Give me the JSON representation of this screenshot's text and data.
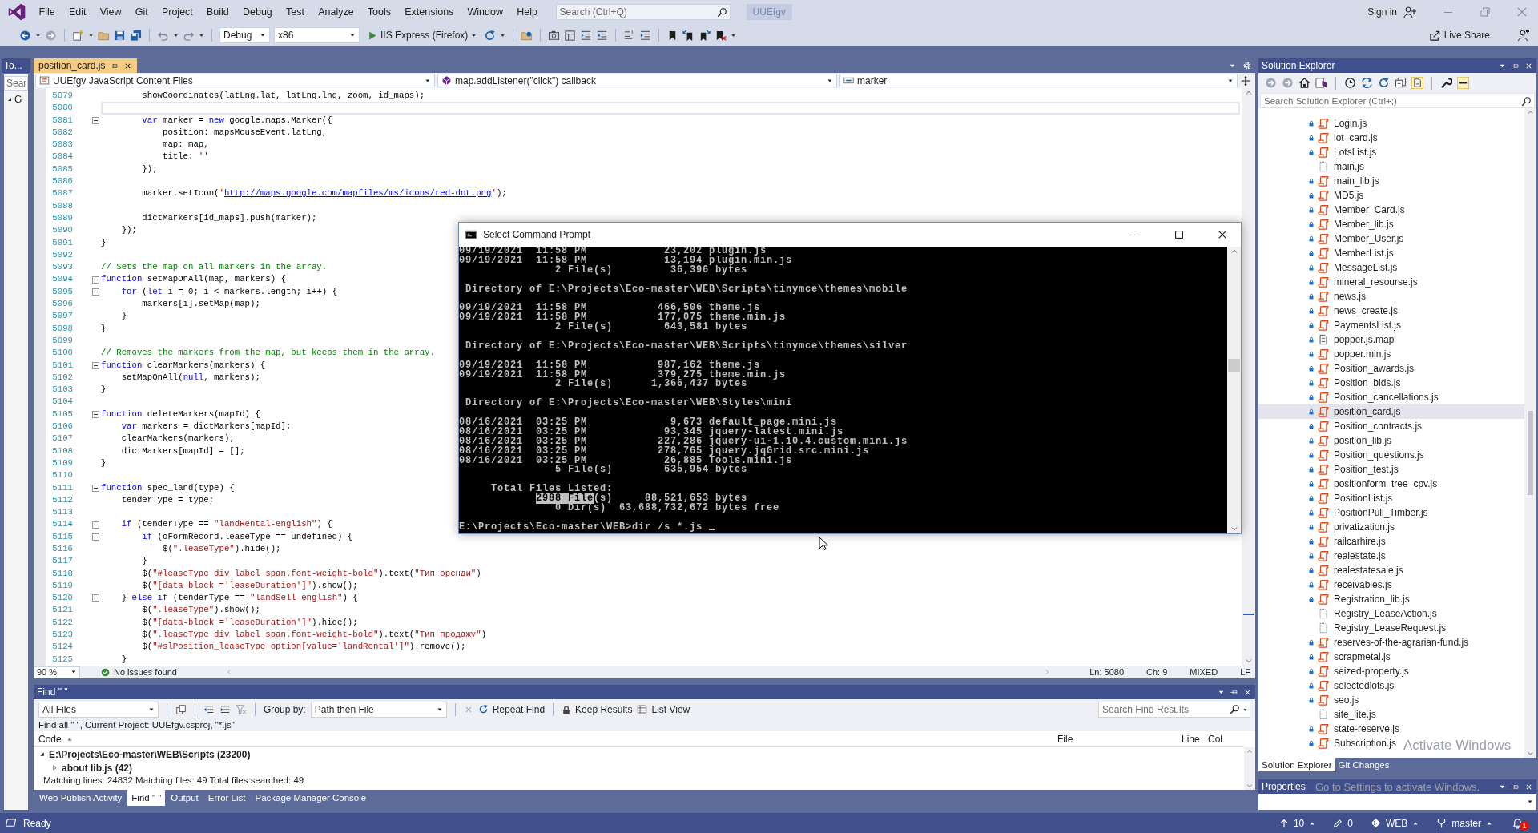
{
  "menu_bar": {
    "items": [
      "File",
      "Edit",
      "View",
      "Git",
      "Project",
      "Build",
      "Debug",
      "Test",
      "Analyze",
      "Tools",
      "Extensions",
      "Window",
      "Help"
    ],
    "search": {
      "placeholder": "Search (Ctrl+Q)"
    },
    "solution_badge": "UUEfgv",
    "sign_in": "Sign in"
  },
  "toolbar": {
    "configuration": "Debug",
    "platform": "x86",
    "run_target": "IIS Express (Firefox)",
    "live_share": "Live Share"
  },
  "left_panel": {
    "tab": "To...",
    "search": {
      "placeholder": "Sear"
    },
    "tree_item": "G"
  },
  "document_tabs": [
    {
      "label": "position_card.js",
      "selected": true
    }
  ],
  "navigation_bar": {
    "project": "UUEfgv JavaScript Content Files",
    "scope": "map.addListener(\"click\") callback",
    "member": "marker"
  },
  "code_lines": [
    {
      "number": "5079",
      "collapsible": false,
      "current": false,
      "segments": [
        {
          "kind": "plain",
          "text": "        showCoordinates(latLng.lat, latLng.lng, zoom, id_maps);"
        }
      ]
    },
    {
      "number": "5080",
      "collapsible": false,
      "current": true
    },
    {
      "number": "5081",
      "collapsible": true,
      "current": false,
      "segments": [
        {
          "kind": "keyword",
          "text": "        var"
        },
        {
          "kind": "plain",
          "text": " marker = "
        },
        {
          "kind": "keyword",
          "text": "new"
        },
        {
          "kind": "plain",
          "text": " google.maps.Marker({"
        }
      ]
    },
    {
      "number": "5082",
      "collapsible": false,
      "current": false,
      "segments": [
        {
          "kind": "plain",
          "text": "            position: mapsMouseEvent.latLng,"
        }
      ]
    },
    {
      "number": "5083",
      "collapsible": false,
      "current": false,
      "segments": [
        {
          "kind": "plain",
          "text": "            map: map,"
        }
      ]
    },
    {
      "number": "5084",
      "collapsible": false,
      "current": false,
      "segments": [
        {
          "kind": "plain",
          "text": "            title: "
        },
        {
          "kind": "string",
          "text": "''"
        }
      ]
    },
    {
      "number": "5085",
      "collapsible": false,
      "current": false,
      "segments": [
        {
          "kind": "plain",
          "text": "        });"
        }
      ]
    },
    {
      "number": "5086",
      "collapsible": false,
      "current": false
    },
    {
      "number": "5087",
      "collapsible": false,
      "current": false,
      "segments": [
        {
          "kind": "plain",
          "text": "        marker.setIcon("
        },
        {
          "kind": "string",
          "text": "'"
        },
        {
          "kind": "link",
          "text": "http://maps.google.com/mapfiles/ms/icons/red-dot.png"
        },
        {
          "kind": "string",
          "text": "'"
        },
        {
          "kind": "plain",
          "text": ");"
        }
      ]
    },
    {
      "number": "5088",
      "collapsible": false,
      "current": false
    },
    {
      "number": "5089",
      "collapsible": false,
      "current": false,
      "segments": [
        {
          "kind": "plain",
          "text": "        dictMarkers[id_maps].push(marker);"
        }
      ]
    },
    {
      "number": "5090",
      "collapsible": false,
      "current": false,
      "segments": [
        {
          "kind": "plain",
          "text": "    });"
        }
      ]
    },
    {
      "number": "5091",
      "collapsible": false,
      "current": false,
      "segments": [
        {
          "kind": "plain",
          "text": "}"
        }
      ]
    },
    {
      "number": "5092",
      "collapsible": false,
      "current": false
    },
    {
      "number": "5093",
      "collapsible": false,
      "current": false,
      "segments": [
        {
          "kind": "comment",
          "text": "// Sets the map on all markers in the array."
        }
      ]
    },
    {
      "number": "5094",
      "collapsible": true,
      "current": false,
      "segments": [
        {
          "kind": "keyword",
          "text": "function"
        },
        {
          "kind": "plain",
          "text": " setMapOnAll(map, markers) {"
        }
      ]
    },
    {
      "number": "5095",
      "collapsible": true,
      "current": false,
      "segments": [
        {
          "kind": "keyword",
          "text": "    for"
        },
        {
          "kind": "plain",
          "text": " ("
        },
        {
          "kind": "keyword",
          "text": "let"
        },
        {
          "kind": "plain",
          "text": " i = 0; i < markers.length; i++) {"
        }
      ]
    },
    {
      "number": "5096",
      "collapsible": false,
      "current": false,
      "segments": [
        {
          "kind": "plain",
          "text": "        markers[i].setMap(map);"
        }
      ]
    },
    {
      "number": "5097",
      "collapsible": false,
      "current": false,
      "segments": [
        {
          "kind": "plain",
          "text": "    }"
        }
      ]
    },
    {
      "number": "5098",
      "collapsible": false,
      "current": false,
      "segments": [
        {
          "kind": "plain",
          "text": "}"
        }
      ]
    },
    {
      "number": "5099",
      "collapsible": false,
      "current": false
    },
    {
      "number": "5100",
      "collapsible": false,
      "current": false,
      "segments": [
        {
          "kind": "comment",
          "text": "// Removes the markers from the map, but keeps them in the array."
        }
      ]
    },
    {
      "number": "5101",
      "collapsible": true,
      "current": false,
      "segments": [
        {
          "kind": "keyword",
          "text": "function"
        },
        {
          "kind": "plain",
          "text": " clearMarkers(markers) {"
        }
      ]
    },
    {
      "number": "5102",
      "collapsible": false,
      "current": false,
      "segments": [
        {
          "kind": "plain",
          "text": "    setMapOnAll("
        },
        {
          "kind": "keyword",
          "text": "null"
        },
        {
          "kind": "plain",
          "text": ", markers);"
        }
      ]
    },
    {
      "number": "5103",
      "collapsible": false,
      "current": false,
      "segments": [
        {
          "kind": "plain",
          "text": "}"
        }
      ]
    },
    {
      "number": "5104",
      "collapsible": false,
      "current": false
    },
    {
      "number": "5105",
      "collapsible": true,
      "current": false,
      "segments": [
        {
          "kind": "keyword",
          "text": "function"
        },
        {
          "kind": "plain",
          "text": " deleteMarkers(mapId) {"
        }
      ]
    },
    {
      "number": "5106",
      "collapsible": false,
      "current": false,
      "segments": [
        {
          "kind": "keyword",
          "text": "    var"
        },
        {
          "kind": "plain",
          "text": " markers = dictMarkers[mapId];"
        }
      ]
    },
    {
      "number": "5107",
      "collapsible": false,
      "current": false,
      "segments": [
        {
          "kind": "plain",
          "text": "    clearMarkers(markers);"
        }
      ]
    },
    {
      "number": "5108",
      "collapsible": false,
      "current": false,
      "segments": [
        {
          "kind": "plain",
          "text": "    dictMarkers[mapId] = [];"
        }
      ]
    },
    {
      "number": "5109",
      "collapsible": false,
      "current": false,
      "segments": [
        {
          "kind": "plain",
          "text": "}"
        }
      ]
    },
    {
      "number": "5110",
      "collapsible": false,
      "current": false
    },
    {
      "number": "5111",
      "collapsible": true,
      "current": false,
      "segments": [
        {
          "kind": "keyword",
          "text": "function"
        },
        {
          "kind": "plain",
          "text": " spec_land(type) {"
        }
      ]
    },
    {
      "number": "5112",
      "collapsible": false,
      "current": false,
      "segments": [
        {
          "kind": "plain",
          "text": "    tenderType = type;"
        }
      ]
    },
    {
      "number": "5113",
      "collapsible": false,
      "current": false
    },
    {
      "number": "5114",
      "collapsible": true,
      "current": false,
      "segments": [
        {
          "kind": "keyword",
          "text": "    if"
        },
        {
          "kind": "plain",
          "text": " (tenderType == "
        },
        {
          "kind": "string",
          "text": "\"landRental-english\""
        },
        {
          "kind": "plain",
          "text": ") {"
        }
      ]
    },
    {
      "number": "5115",
      "collapsible": true,
      "current": false,
      "segments": [
        {
          "kind": "keyword",
          "text": "        if"
        },
        {
          "kind": "plain",
          "text": " (oFormRecord.leaseType == undefined) {"
        }
      ]
    },
    {
      "number": "5116",
      "collapsible": false,
      "current": false,
      "segments": [
        {
          "kind": "plain",
          "text": "            $("
        },
        {
          "kind": "string",
          "text": "\".leaseType\""
        },
        {
          "kind": "plain",
          "text": ").hide();"
        }
      ]
    },
    {
      "number": "5117",
      "collapsible": false,
      "current": false,
      "segments": [
        {
          "kind": "plain",
          "text": "        }"
        }
      ]
    },
    {
      "number": "5118",
      "collapsible": false,
      "current": false,
      "segments": [
        {
          "kind": "plain",
          "text": "        $("
        },
        {
          "kind": "string",
          "text": "\"#leaseType div label span.font-weight-bold\""
        },
        {
          "kind": "plain",
          "text": ").text("
        },
        {
          "kind": "string",
          "text": "\"Тип оренди\""
        },
        {
          "kind": "plain",
          "text": ")"
        }
      ]
    },
    {
      "number": "5119",
      "collapsible": false,
      "current": false,
      "segments": [
        {
          "kind": "plain",
          "text": "        $("
        },
        {
          "kind": "string",
          "text": "\"[data-block ='leaseDuration']\""
        },
        {
          "kind": "plain",
          "text": ").show();"
        }
      ]
    },
    {
      "number": "5120",
      "collapsible": true,
      "current": false,
      "segments": [
        {
          "kind": "plain",
          "text": "    } "
        },
        {
          "kind": "keyword",
          "text": "else if"
        },
        {
          "kind": "plain",
          "text": " (tenderType == "
        },
        {
          "kind": "string",
          "text": "\"landSell-english\""
        },
        {
          "kind": "plain",
          "text": ") {"
        }
      ]
    },
    {
      "number": "5121",
      "collapsible": false,
      "current": false,
      "segments": [
        {
          "kind": "plain",
          "text": "        $("
        },
        {
          "kind": "string",
          "text": "\".leaseType\""
        },
        {
          "kind": "plain",
          "text": ").show();"
        }
      ]
    },
    {
      "number": "5122",
      "collapsible": false,
      "current": false,
      "segments": [
        {
          "kind": "plain",
          "text": "        $("
        },
        {
          "kind": "string",
          "text": "\"[data-block ='leaseDuration']\""
        },
        {
          "kind": "plain",
          "text": ").hide();"
        }
      ]
    },
    {
      "number": "5123",
      "collapsible": false,
      "current": false,
      "segments": [
        {
          "kind": "plain",
          "text": "        $("
        },
        {
          "kind": "string",
          "text": "\".leaseType div label span.font-weight-bold\""
        },
        {
          "kind": "plain",
          "text": ").text("
        },
        {
          "kind": "string",
          "text": "\"Тип продажу\""
        },
        {
          "kind": "plain",
          "text": ")"
        }
      ]
    },
    {
      "number": "5124",
      "collapsible": false,
      "current": false,
      "segments": [
        {
          "kind": "plain",
          "text": "        $("
        },
        {
          "kind": "string",
          "text": "\"#slPosition_leaseType option[value='landRental']\""
        },
        {
          "kind": "plain",
          "text": ").remove();"
        }
      ]
    },
    {
      "number": "5125",
      "collapsible": false,
      "current": false,
      "segments": [
        {
          "kind": "plain",
          "text": "    }"
        }
      ]
    }
  ],
  "editor_status": {
    "zoom": "90 %",
    "issues": "No issues found",
    "line": "Ln: 5080",
    "column": "Ch: 9",
    "encoding": "MIXED",
    "line_endings": "LF"
  },
  "find_panel": {
    "title": "Find \" \"",
    "scope": "All Files",
    "group_by_label": "Group by:",
    "group_by": "Path then File",
    "repeat_find": "Repeat Find",
    "keep_results": "Keep Results",
    "list_view": "List View",
    "search": {
      "placeholder": "Search Find Results"
    },
    "summary": "Find all \" \", Current Project: UUEfgv.csproj, \"*.js\"",
    "columns": [
      {
        "label": "Code",
        "sorted": true
      },
      {
        "label": "File",
        "sorted": false
      },
      {
        "label": "Line",
        "sorted": false
      },
      {
        "label": "Col",
        "sorted": false
      }
    ],
    "results": [
      {
        "text": "E:\\Projects\\Eco-master\\WEB\\Scripts (23200)",
        "expanded": true,
        "children": [
          {
            "text": "about lib.js (42)",
            "expanded": false
          }
        ]
      }
    ],
    "footer": "Matching lines: 24832 Matching files: 49 Total files searched: 49"
  },
  "bottom_tabs": [
    {
      "label": "Web Publish Activity",
      "selected": false
    },
    {
      "label": "Find \" \"",
      "selected": true
    },
    {
      "label": "Output",
      "selected": false
    },
    {
      "label": "Error List",
      "selected": false
    },
    {
      "label": "Package Manager Console",
      "selected": false
    }
  ],
  "solution_explorer": {
    "title": "Solution Explorer",
    "search": {
      "placeholder": "Search Solution Explorer (Ctrl+;)"
    },
    "items": [
      {
        "name": "Login.js",
        "kind": "script",
        "locked": true,
        "selected": false
      },
      {
        "name": "lot_card.js",
        "kind": "script",
        "locked": true,
        "selected": false
      },
      {
        "name": "LotsList.js",
        "kind": "script",
        "locked": true,
        "selected": false
      },
      {
        "name": "main.js",
        "kind": "blank",
        "locked": false,
        "selected": false
      },
      {
        "name": "main_lib.js",
        "kind": "script",
        "locked": true,
        "selected": false
      },
      {
        "name": "MD5.js",
        "kind": "script",
        "locked": true,
        "selected": false
      },
      {
        "name": "Member_Card.js",
        "kind": "script",
        "locked": true,
        "selected": false
      },
      {
        "name": "Member_lib.js",
        "kind": "script",
        "locked": true,
        "selected": false
      },
      {
        "name": "Member_User.js",
        "kind": "script",
        "locked": true,
        "selected": false
      },
      {
        "name": "MemberList.js",
        "kind": "script",
        "locked": true,
        "selected": false
      },
      {
        "name": "MessageList.js",
        "kind": "script",
        "locked": true,
        "selected": false
      },
      {
        "name": "mineral_resourse.js",
        "kind": "script",
        "locked": true,
        "selected": false
      },
      {
        "name": "news.js",
        "kind": "script",
        "locked": true,
        "selected": false
      },
      {
        "name": "news_create.js",
        "kind": "script",
        "locked": true,
        "selected": false
      },
      {
        "name": "PaymentsList.js",
        "kind": "script",
        "locked": true,
        "selected": false
      },
      {
        "name": "popper.js.map",
        "kind": "document",
        "locked": true,
        "selected": false
      },
      {
        "name": "popper.min.js",
        "kind": "script",
        "locked": true,
        "selected": false
      },
      {
        "name": "Position_awards.js",
        "kind": "script",
        "locked": true,
        "selected": false
      },
      {
        "name": "Position_bids.js",
        "kind": "script",
        "locked": true,
        "selected": false
      },
      {
        "name": "Position_cancellations.js",
        "kind": "script",
        "locked": true,
        "selected": false
      },
      {
        "name": "position_card.js",
        "kind": "script",
        "locked": true,
        "selected": true
      },
      {
        "name": "Position_contracts.js",
        "kind": "script",
        "locked": true,
        "selected": false
      },
      {
        "name": "position_lib.js",
        "kind": "script",
        "locked": true,
        "selected": false
      },
      {
        "name": "Position_questions.js",
        "kind": "script",
        "locked": true,
        "selected": false
      },
      {
        "name": "Position_test.js",
        "kind": "script",
        "locked": true,
        "selected": false
      },
      {
        "name": "positionform_tree_cpv.js",
        "kind": "script",
        "locked": true,
        "selected": false
      },
      {
        "name": "PositionList.js",
        "kind": "script",
        "locked": true,
        "selected": false
      },
      {
        "name": "PositionPull_Timber.js",
        "kind": "script",
        "locked": true,
        "selected": false
      },
      {
        "name": "privatization.js",
        "kind": "script",
        "locked": true,
        "selected": false
      },
      {
        "name": "railcarhire.js",
        "kind": "script",
        "locked": true,
        "selected": false
      },
      {
        "name": "realestate.js",
        "kind": "script",
        "locked": true,
        "selected": false
      },
      {
        "name": "realestatesale.js",
        "kind": "script",
        "locked": true,
        "selected": false
      },
      {
        "name": "receivables.js",
        "kind": "script",
        "locked": true,
        "selected": false
      },
      {
        "name": "Registration_lib.js",
        "kind": "script",
        "locked": true,
        "selected": false
      },
      {
        "name": "Registry_LeaseAction.js",
        "kind": "blank",
        "locked": false,
        "selected": false
      },
      {
        "name": "Registry_LeaseRequest.js",
        "kind": "blank",
        "locked": false,
        "selected": false
      },
      {
        "name": "reserves-of-the-agrarian-fund.js",
        "kind": "script",
        "locked": true,
        "selected": false
      },
      {
        "name": "scrapmetal.js",
        "kind": "script",
        "locked": true,
        "selected": false
      },
      {
        "name": "seized-property.js",
        "kind": "script",
        "locked": true,
        "selected": false
      },
      {
        "name": "selectedlots.js",
        "kind": "script",
        "locked": true,
        "selected": false
      },
      {
        "name": "seo.js",
        "kind": "script",
        "locked": true,
        "selected": false
      },
      {
        "name": "site_lite.js",
        "kind": "blank",
        "locked": false,
        "selected": false
      },
      {
        "name": "state-reserve.js",
        "kind": "script",
        "locked": true,
        "selected": false
      },
      {
        "name": "Subscription.js",
        "kind": "script",
        "locked": true,
        "selected": false
      }
    ],
    "tabs": [
      {
        "label": "Solution Explorer",
        "selected": true
      },
      {
        "label": "Git Changes",
        "selected": false
      }
    ]
  },
  "properties": {
    "title": "Properties"
  },
  "command_prompt": {
    "title": "Select Command Prompt",
    "blocks": [
      [
        {
          "text": "09/19/2021  11:58 PM            23,202 plugin.js"
        },
        {
          "text": "09/19/2021  11:58 PM            13,194 plugin.min.js"
        },
        {
          "text": "               2 File(s)         36,396 bytes"
        }
      ],
      [
        {
          "text": " Directory of E:\\Projects\\Eco-master\\WEB\\Scripts\\tinymce\\themes\\mobile"
        }
      ],
      [
        {
          "text": "09/19/2021  11:58 PM           466,506 theme.js"
        },
        {
          "text": "09/19/2021  11:58 PM           177,075 theme.min.js"
        },
        {
          "text": "               2 File(s)        643,581 bytes"
        }
      ],
      [
        {
          "text": " Directory of E:\\Projects\\Eco-master\\WEB\\Scripts\\tinymce\\themes\\silver"
        }
      ],
      [
        {
          "text": "09/19/2021  11:58 PM           987,162 theme.js"
        },
        {
          "text": "09/19/2021  11:58 PM           379,275 theme.min.js"
        },
        {
          "text": "               2 File(s)      1,366,437 bytes"
        }
      ],
      [
        {
          "text": " Directory of E:\\Projects\\Eco-master\\WEB\\Styles\\mini"
        }
      ],
      [
        {
          "text": "08/16/2021  03:25 PM             9,673 default_page.mini.js"
        },
        {
          "text": "08/16/2021  03:25 PM            93,345 jquery-latest.mini.js"
        },
        {
          "text": "08/16/2021  03:25 PM           227,286 jquery-ui-1.10.4.custom.mini.js"
        },
        {
          "text": "08/16/2021  03:25 PM           278,765 jquery.jqGrid.src.mini.js"
        },
        {
          "text": "08/16/2021  03:25 PM            26,885 Tools.mini.js"
        },
        {
          "text": "               5 File(s)        635,954 bytes"
        }
      ],
      [
        {
          "text": "     Total Files Listed:"
        },
        {
          "segments": [
            {
              "text": "2988 File",
              "selected": true
            },
            {
              "text": "(s)     88,521,653 bytes",
              "selected": false
            }
          ]
        },
        {
          "text": "               0 Dir(s)  63,688,732,672 bytes free"
        }
      ]
    ],
    "prompt": "E:\\Projects\\Eco-master\\WEB>dir /s *.js"
  },
  "status_bar": {
    "status": "Ready",
    "commits": "10",
    "changes": "0",
    "repository": "WEB",
    "branch": "master",
    "notifications": "1"
  },
  "system_overlay": {
    "title": "Activate Windows",
    "message": "Go to Settings to activate Windows."
  }
}
